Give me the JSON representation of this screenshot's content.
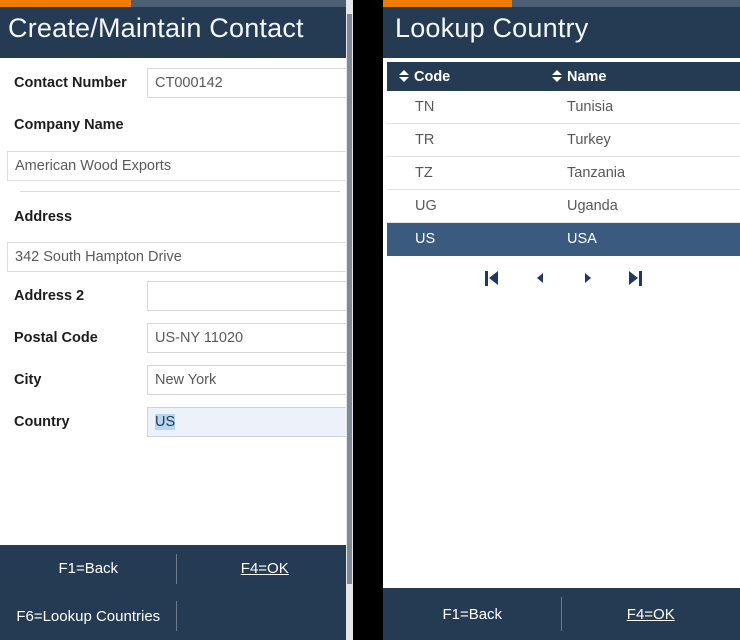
{
  "left_panel": {
    "progress_percent": 37,
    "title": "Create/Maintain Contact",
    "fields": {
      "contact_number": {
        "label": "Contact Number",
        "value": "CT000142"
      },
      "company_name": {
        "label": "Company Name",
        "value": "American Wood Exports"
      },
      "address": {
        "label": "Address",
        "value": "342 South Hampton Drive"
      },
      "address2": {
        "label": "Address 2",
        "value": ""
      },
      "postal_code": {
        "label": "Postal Code",
        "value": "US-NY 11020"
      },
      "city": {
        "label": "City",
        "value": "New York"
      },
      "country": {
        "label": "Country",
        "value": "US"
      }
    },
    "footer": {
      "f1_back": "F1=Back",
      "f4_ok": "F4=OK",
      "f6_lookup": "F6=Lookup Countries",
      "blank": ""
    }
  },
  "right_panel": {
    "progress_percent": 36,
    "title": "Lookup Country",
    "table": {
      "columns": [
        {
          "key": "code",
          "label": "Code",
          "sort_icon": "sort-updown-icon"
        },
        {
          "key": "name",
          "label": "Name",
          "sort_icon": "sort-updown-icon"
        }
      ],
      "rows": [
        {
          "code": "TN",
          "name": "Tunisia",
          "selected": false
        },
        {
          "code": "TR",
          "name": "Turkey",
          "selected": false
        },
        {
          "code": "TZ",
          "name": "Tanzania",
          "selected": false
        },
        {
          "code": "UG",
          "name": "Uganda",
          "selected": false
        },
        {
          "code": "US",
          "name": "USA",
          "selected": true
        }
      ]
    },
    "pagination": {
      "first": "first-page-icon",
      "prev": "previous-page-icon",
      "next": "next-page-icon",
      "last": "last-page-icon"
    },
    "footer": {
      "f1_back": "F1=Back",
      "f4_ok": "F4=OK"
    }
  },
  "colors": {
    "navy": "#253b53",
    "orange": "#ef7c00",
    "progress_track": "#4c5f74",
    "row_selected": "#3a5a80",
    "focus_bg": "#edf1fa",
    "text_selection": "#b8d4f5"
  }
}
